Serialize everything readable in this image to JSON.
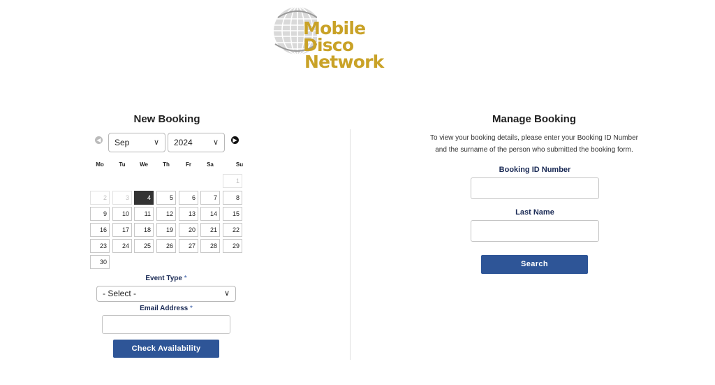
{
  "logo": {
    "line1": "Mobile Disco",
    "line2": "Network",
    "color": "#c9a227"
  },
  "new_booking": {
    "title": "New Booking",
    "month": "Sep",
    "year": "2024",
    "weekdays": [
      "Mo",
      "Tu",
      "We",
      "Th",
      "Fr",
      "Sa",
      "Su"
    ],
    "days": [
      {
        "label": "1",
        "state": "disabled"
      },
      {
        "label": "2",
        "state": "disabled"
      },
      {
        "label": "3",
        "state": "disabled"
      },
      {
        "label": "4",
        "state": "selected"
      },
      {
        "label": "5"
      },
      {
        "label": "6"
      },
      {
        "label": "7"
      },
      {
        "label": "8"
      },
      {
        "label": "9"
      },
      {
        "label": "10"
      },
      {
        "label": "11"
      },
      {
        "label": "12"
      },
      {
        "label": "13"
      },
      {
        "label": "14"
      },
      {
        "label": "15"
      },
      {
        "label": "16"
      },
      {
        "label": "17"
      },
      {
        "label": "18"
      },
      {
        "label": "19"
      },
      {
        "label": "20"
      },
      {
        "label": "21"
      },
      {
        "label": "22"
      },
      {
        "label": "23"
      },
      {
        "label": "24"
      },
      {
        "label": "25"
      },
      {
        "label": "26"
      },
      {
        "label": "27"
      },
      {
        "label": "28"
      },
      {
        "label": "29"
      },
      {
        "label": "30"
      }
    ],
    "event_type_label": "Event Type",
    "event_type_value": "- Select -",
    "email_label": "Email Address",
    "required_mark": "*",
    "email_value": "",
    "check_button": "Check Availability"
  },
  "manage_booking": {
    "title": "Manage Booking",
    "description_line1": "To view your booking details, please enter your Booking ID Number",
    "description_line2": "and the surname of the person who submitted the booking form.",
    "booking_id_label": "Booking ID Number",
    "booking_id_value": "",
    "last_name_label": "Last Name",
    "last_name_value": "",
    "search_button": "Search"
  },
  "colors": {
    "accent": "#2e5597",
    "label": "#1a2a55",
    "selected_day": "#333333"
  }
}
